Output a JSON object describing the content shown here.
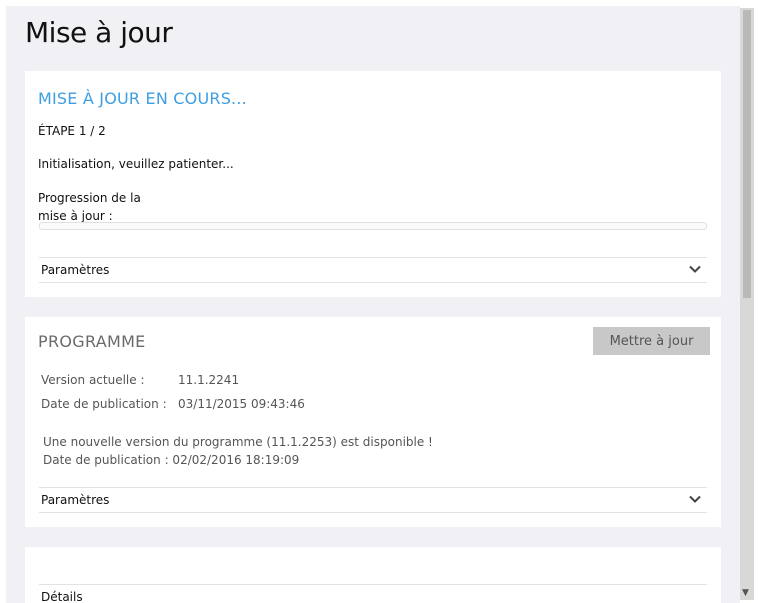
{
  "page": {
    "title": "Mise à jour"
  },
  "update_card": {
    "heading": "MISE À JOUR EN COURS...",
    "step": "ÉTAPE 1 / 2",
    "status": "Initialisation, veuillez patienter...",
    "progress_label_line1": "Progression de la",
    "progress_label_line2": "mise à jour :",
    "progress_fraction": 0,
    "settings_label": "Paramètres"
  },
  "program_card": {
    "heading": "PROGRAMME",
    "update_button": "Mettre à jour",
    "current_version_label": "Version actuelle :",
    "current_version_value": "11.1.2241",
    "publication_label": "Date de publication :",
    "publication_value": "03/11/2015 09:43:46",
    "new_version_notice": "Une nouvelle version du programme (11.1.2253) est disponible !",
    "new_version_date": "Date de publication : 02/02/2016 18:19:09",
    "settings_label": "Paramètres"
  },
  "details_card": {
    "label": "Détails"
  },
  "colors": {
    "accent": "#3d9fe1",
    "background": "#f0f0f5",
    "button_disabled": "#c8c8c8"
  }
}
